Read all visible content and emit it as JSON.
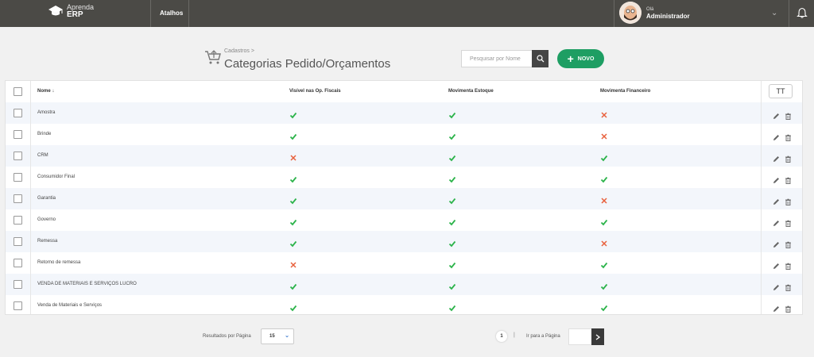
{
  "topbar": {
    "brand_line1": "Aprenda",
    "brand_line2": "ERP",
    "shortcuts_label": "Atalhos",
    "greeting": "Olá",
    "user_name": "Administrador"
  },
  "header": {
    "breadcrumb": "Cadastros  >",
    "title": "Categorias Pedido/Orçamentos",
    "search_placeholder": "Pesquisar por Nome",
    "new_button_label": "NOVO"
  },
  "table": {
    "columns": {
      "name": "Nome ↓",
      "visible_fiscal": "Visível nas Op. Fiscais",
      "moves_stock": "Movimenta Estoque",
      "moves_finance": "Movimenta Financeiro",
      "config_glyph": "TT"
    },
    "rows": [
      {
        "name": "Amostra",
        "fiscal": true,
        "stock": true,
        "finance": false
      },
      {
        "name": "Brinde",
        "fiscal": true,
        "stock": true,
        "finance": false
      },
      {
        "name": "CRM",
        "fiscal": false,
        "stock": true,
        "finance": true
      },
      {
        "name": "Consumidor Final",
        "fiscal": true,
        "stock": true,
        "finance": true
      },
      {
        "name": "Garantia",
        "fiscal": true,
        "stock": true,
        "finance": false
      },
      {
        "name": "Governo",
        "fiscal": true,
        "stock": true,
        "finance": true
      },
      {
        "name": "Remessa",
        "fiscal": true,
        "stock": true,
        "finance": false
      },
      {
        "name": "Retorno de remessa",
        "fiscal": false,
        "stock": true,
        "finance": true
      },
      {
        "name": "VENDA DE MATERIAIS E SERVIÇOS LUCRO",
        "fiscal": true,
        "stock": true,
        "finance": true
      },
      {
        "name": "Venda de Materiais e Serviços",
        "fiscal": true,
        "stock": true,
        "finance": true
      }
    ]
  },
  "footer": {
    "per_page_label": "Resultados por Página",
    "per_page_value": "15",
    "current_page": "1",
    "page_separator": "|",
    "goto_label": "Ir para a Página"
  },
  "colors": {
    "topbar": "#4b4a46",
    "accent_green": "#1e9e63",
    "check": "#2bb34a",
    "cross": "#e8603c"
  }
}
